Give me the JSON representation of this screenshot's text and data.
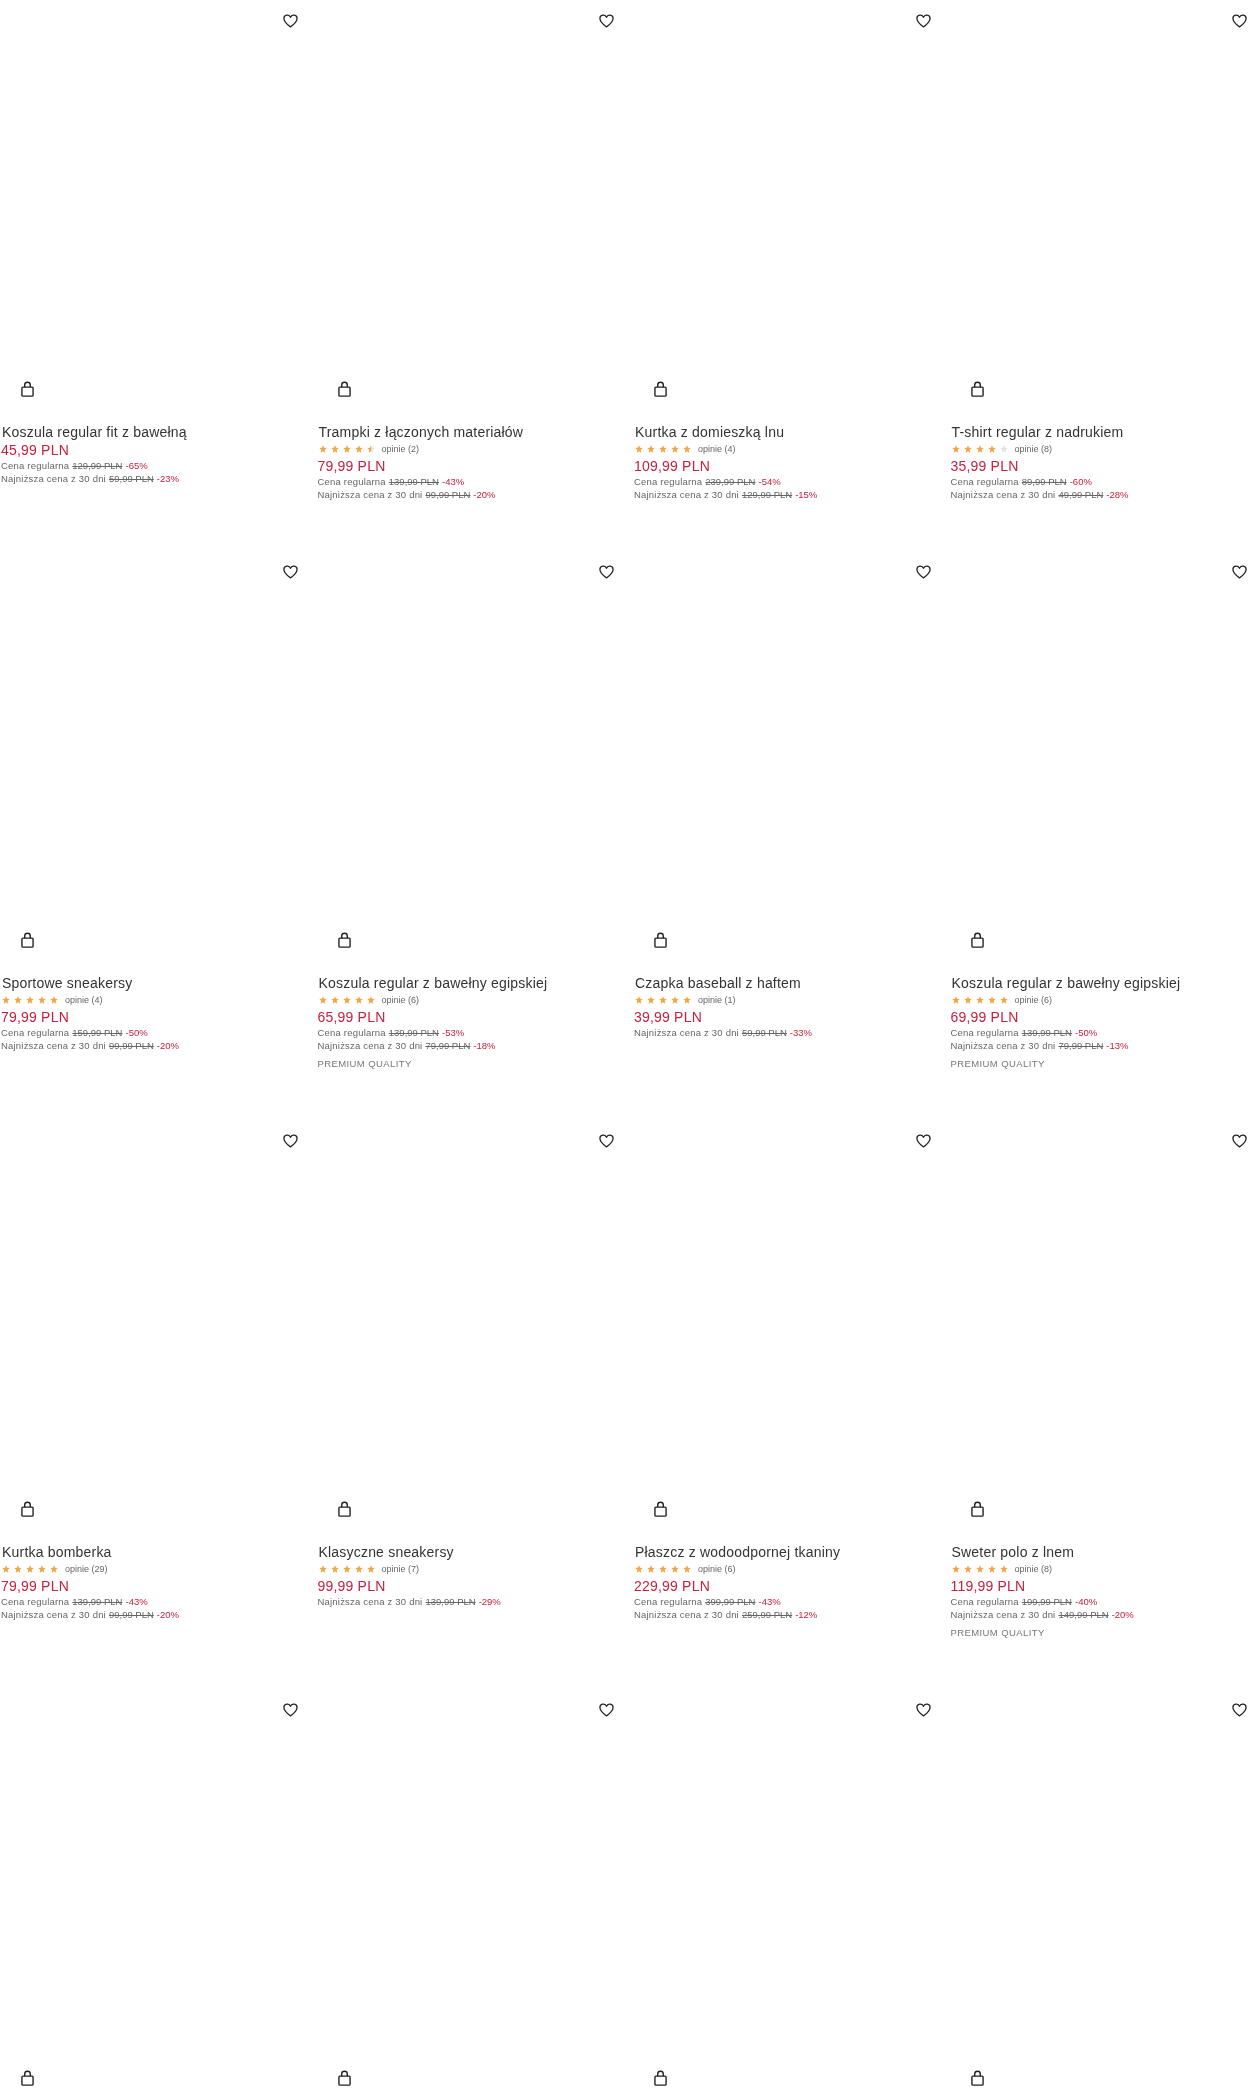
{
  "products": [
    {
      "name": "Koszula regular fit z bawełną",
      "favorite": false,
      "price": "45,99 PLN",
      "price_notes": [
        {
          "label": "Cena regularna",
          "old": "129,99 PLN",
          "discount": "-65%"
        },
        {
          "label": "Najniższa cena z 30 dni",
          "old": "59,99 PLN",
          "discount": "-23%"
        }
      ]
    },
    {
      "name": "Trampki z łączonych materiałów",
      "favorite": false,
      "stars": 4.5,
      "reviews": "opinie (2)",
      "price": "79,99 PLN",
      "price_notes": [
        {
          "label": "Cena regularna",
          "old": "139,99 PLN",
          "discount": "-43%"
        },
        {
          "label": "Najniższa cena z 30 dni",
          "old": "99,99 PLN",
          "discount": "-20%"
        }
      ]
    },
    {
      "name": "Kurtka z domieszką lnu",
      "favorite": false,
      "stars": 5,
      "reviews": "opinie (4)",
      "price": "109,99 PLN",
      "price_notes": [
        {
          "label": "Cena regularna",
          "old": "239,99 PLN",
          "discount": "-54%"
        },
        {
          "label": "Najniższa cena z 30 dni",
          "old": "129,99 PLN",
          "discount": "-15%"
        }
      ]
    },
    {
      "name": "T-shirt regular z nadrukiem",
      "favorite": false,
      "stars": 4,
      "reviews": "opinie (8)",
      "price": "35,99 PLN",
      "price_notes": [
        {
          "label": "Cena regularna",
          "old": "89,99 PLN",
          "discount": "-60%"
        },
        {
          "label": "Najniższa cena z 30 dni",
          "old": "49,99 PLN",
          "discount": "-28%"
        }
      ]
    },
    {
      "name": "Sportowe sneakersy",
      "favorite": false,
      "stars": 5,
      "reviews": "opinie (4)",
      "price": "79,99 PLN",
      "price_notes": [
        {
          "label": "Cena regularna",
          "old": "159,99 PLN",
          "discount": "-50%"
        },
        {
          "label": "Najniższa cena z 30 dni",
          "old": "99,99 PLN",
          "discount": "-20%"
        }
      ]
    },
    {
      "name": "Koszula regular z bawełny egipskiej",
      "favorite": false,
      "stars": 5,
      "reviews": "opinie (6)",
      "price": "65,99 PLN",
      "price_notes": [
        {
          "label": "Cena regularna",
          "old": "139,99 PLN",
          "discount": "-53%"
        },
        {
          "label": "Najniższa cena z 30 dni",
          "old": "79,99 PLN",
          "discount": "-18%"
        }
      ],
      "badge": "PREMIUM QUALITY"
    },
    {
      "name": "Czapka baseball z haftem",
      "favorite": false,
      "stars": 5,
      "reviews": "opinie (1)",
      "price": "39,99 PLN",
      "price_notes": [
        {
          "label": "Najniższa cena z 30 dni",
          "old": "59,99 PLN",
          "discount": "-33%"
        }
      ]
    },
    {
      "name": "Koszula regular z bawełny egipskiej",
      "favorite": false,
      "stars": 5,
      "reviews": "opinie (6)",
      "price": "69,99 PLN",
      "price_notes": [
        {
          "label": "Cena regularna",
          "old": "139,99 PLN",
          "discount": "-50%"
        },
        {
          "label": "Najniższa cena z 30 dni",
          "old": "79,99 PLN",
          "discount": "-13%"
        }
      ],
      "badge": "PREMIUM QUALITY"
    },
    {
      "name": "Kurtka bomberka",
      "favorite": false,
      "stars": 5,
      "reviews": "opinie (29)",
      "price": "79,99 PLN",
      "price_notes": [
        {
          "label": "Cena regularna",
          "old": "139,99 PLN",
          "discount": "-43%"
        },
        {
          "label": "Najniższa cena z 30 dni",
          "old": "99,99 PLN",
          "discount": "-20%"
        }
      ]
    },
    {
      "name": "Klasyczne sneakersy",
      "favorite": false,
      "stars": 5,
      "reviews": "opinie (7)",
      "price": "99,99 PLN",
      "price_notes": [
        {
          "label": "Najniższa cena z 30 dni",
          "old": "139,99 PLN",
          "discount": "-29%"
        }
      ]
    },
    {
      "name": "Płaszcz z wodoodpornej tkaniny",
      "favorite": false,
      "stars": 5,
      "reviews": "opinie (6)",
      "price": "229,99 PLN",
      "price_notes": [
        {
          "label": "Cena regularna",
          "old": "399,99 PLN",
          "discount": "-43%"
        },
        {
          "label": "Najniższa cena z 30 dni",
          "old": "259,99 PLN",
          "discount": "-12%"
        }
      ]
    },
    {
      "name": "Sweter polo z lnem",
      "favorite": false,
      "stars": 5,
      "reviews": "opinie (8)",
      "price": "119,99 PLN",
      "price_notes": [
        {
          "label": "Cena regularna",
          "old": "199,99 PLN",
          "discount": "-40%"
        },
        {
          "label": "Najniższa cena z 30 dni",
          "old": "149,99 PLN",
          "discount": "-20%"
        }
      ],
      "badge": "PREMIUM QUALITY"
    },
    {
      "favorite": false
    },
    {
      "favorite": false
    },
    {
      "favorite": false
    },
    {
      "favorite": false
    }
  ]
}
